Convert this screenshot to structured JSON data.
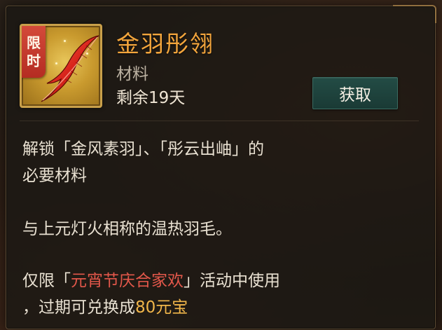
{
  "item": {
    "badge": [
      "限",
      "时"
    ],
    "icon": "red-feather-icon",
    "name": "金羽彤翎",
    "type": "材料",
    "remaining": "剩余19天"
  },
  "actions": {
    "obtain_label": "获取"
  },
  "description": {
    "line1": "解锁「金风素羽」、「彤云出岫」的",
    "line2": "必要材料",
    "line3": "与上元灯火相称的温热羽毛。",
    "line4_prefix": "仅限「",
    "line4_event": "元宵节庆合家欢",
    "line4_suffix": "」活动中使用",
    "line5_prefix": "，过期可兑换成",
    "line5_reward": "80元宝"
  },
  "colors": {
    "title": "#f3a53c",
    "event_highlight": "#e2574a",
    "reward": "#f1b64a",
    "button_bg": "#234c45",
    "badge_bg": "#d44a3a"
  }
}
